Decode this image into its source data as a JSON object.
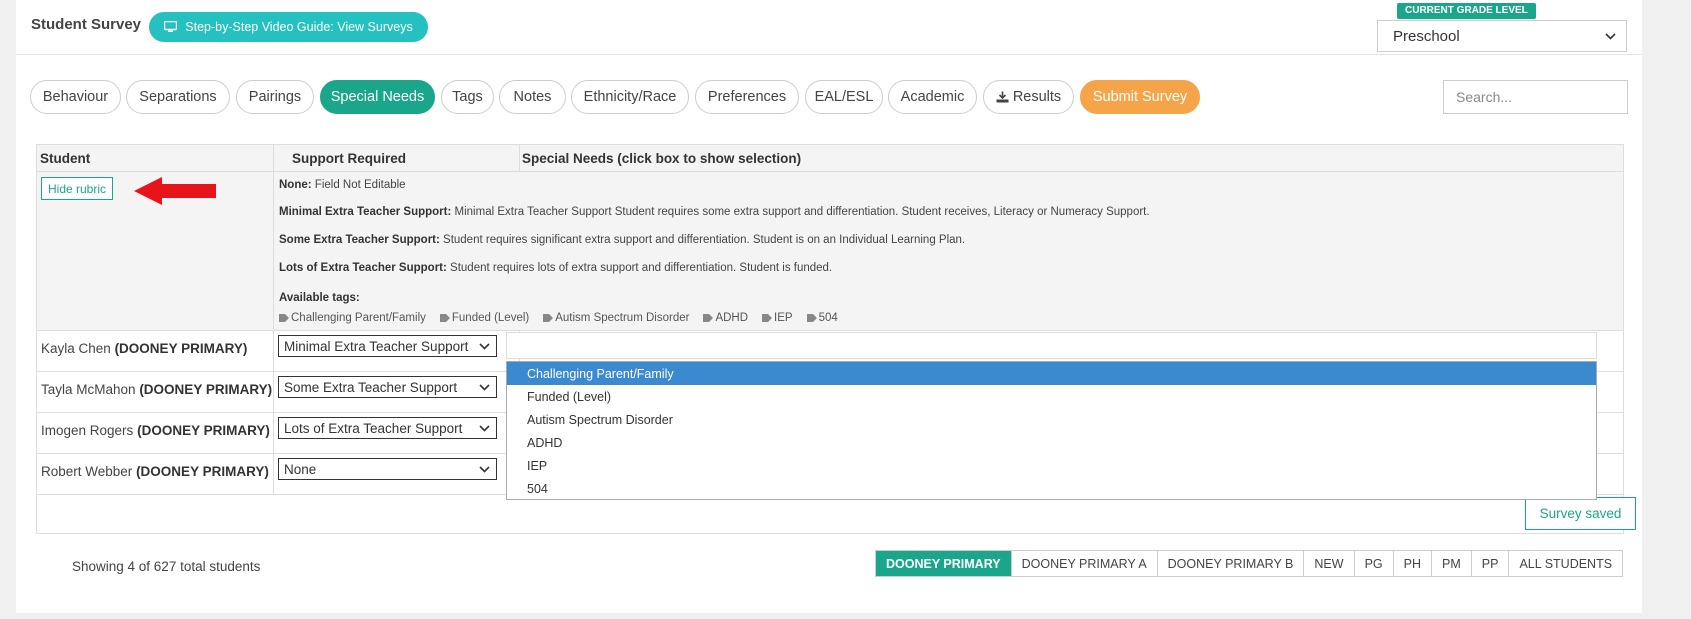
{
  "header": {
    "title": "Student Survey",
    "video_button": "Step-by-Step Video Guide: View Surveys",
    "grade_label": "CURRENT GRADE LEVEL",
    "grade_value": "Preschool"
  },
  "tabs": [
    {
      "label": "Behaviour"
    },
    {
      "label": "Separations"
    },
    {
      "label": "Pairings"
    },
    {
      "label": "Special Needs"
    },
    {
      "label": "Tags"
    },
    {
      "label": "Notes"
    },
    {
      "label": "Ethnicity/Race"
    },
    {
      "label": "Preferences"
    },
    {
      "label": "EAL/ESL"
    },
    {
      "label": "Academic"
    },
    {
      "label": "Results"
    },
    {
      "label": "Submit Survey"
    }
  ],
  "active_tab": "Special Needs",
  "search": {
    "placeholder": "Search..."
  },
  "table": {
    "headers": [
      "Student",
      "Support Required",
      "Special Needs (click box to show selection)"
    ],
    "hide_rubric": "Hide rubric",
    "rubric": [
      {
        "title": "None:",
        "text": " Field Not Editable"
      },
      {
        "title": "Minimal Extra Teacher Support:",
        "text": " Minimal Extra Teacher Support Student requires some extra support and differentiation. Student receives, Literacy or Numeracy Support."
      },
      {
        "title": "Some Extra Teacher Support:",
        "text": " Student requires significant extra support and differentiation. Student is on an Individual Learning Plan."
      },
      {
        "title": "Lots of Extra Teacher Support:",
        "text": " Student requires lots of extra support and differentiation. Student is funded."
      }
    ],
    "available_tags_label": "Available tags:",
    "available_tags": [
      "Challenging Parent/Family",
      "Funded (Level)",
      "Autism Spectrum Disorder",
      "ADHD",
      "IEP",
      "504"
    ],
    "students": [
      {
        "name": "Kayla Chen",
        "school": "(DOONEY PRIMARY)",
        "support": "Minimal Extra Teacher Support"
      },
      {
        "name": "Tayla McMahon",
        "school": "(DOONEY PRIMARY)",
        "support": "Some Extra Teacher Support"
      },
      {
        "name": "Imogen Rogers",
        "school": "(DOONEY PRIMARY)",
        "support": "Lots of Extra Teacher Support"
      },
      {
        "name": "Robert Webber",
        "school": "(DOONEY PRIMARY)",
        "support": "None"
      }
    ]
  },
  "dropdown_options": [
    "Challenging Parent/Family",
    "Funded (Level)",
    "Autism Spectrum Disorder",
    "ADHD",
    "IEP",
    "504"
  ],
  "dropdown_highlighted": "Challenging Parent/Family",
  "survey_saved": "Survey saved",
  "footer": {
    "showing": "Showing 4 of 627 total students",
    "filters": [
      "DOONEY PRIMARY",
      "DOONEY PRIMARY A",
      "DOONEY PRIMARY B",
      "NEW",
      "PG",
      "PH",
      "PM",
      "PP",
      "ALL STUDENTS"
    ],
    "active_filter": "DOONEY PRIMARY"
  },
  "colors": {
    "accent": "#1aa68a",
    "video_button": "#25c1c1",
    "submit": "#f5a44a",
    "highlight": "#3b8ad0",
    "arrow": "#e8141c"
  },
  "icons": {
    "video": "monitor-icon",
    "results": "download-icon",
    "tag": "tag-icon",
    "select": "chevron-down-icon"
  }
}
